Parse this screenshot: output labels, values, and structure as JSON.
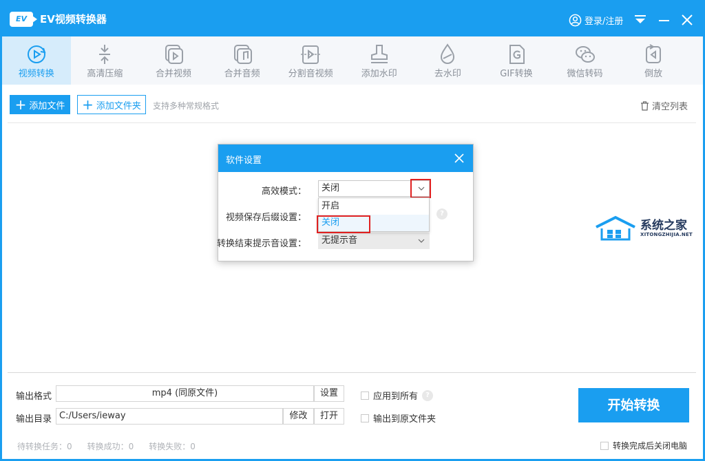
{
  "window": {
    "title": "EV视频转换器",
    "logo_text": "EV",
    "login_label": "登录/注册"
  },
  "toolbar": {
    "tools": [
      {
        "label": "视频转换",
        "icon": "video-convert-icon",
        "active": true
      },
      {
        "label": "高清压缩",
        "icon": "compress-icon"
      },
      {
        "label": "合并视频",
        "icon": "merge-video-icon"
      },
      {
        "label": "合并音频",
        "icon": "merge-audio-icon"
      },
      {
        "label": "分割音视频",
        "icon": "split-icon"
      },
      {
        "label": "添加水印",
        "icon": "stamp-icon"
      },
      {
        "label": "去水印",
        "icon": "drop-icon"
      },
      {
        "label": "GIF转换",
        "icon": "gif-icon"
      },
      {
        "label": "微信转码",
        "icon": "wechat-icon"
      },
      {
        "label": "倒放",
        "icon": "reverse-icon"
      }
    ]
  },
  "actions": {
    "add_file": "添加文件",
    "add_folder": "添加文件夹",
    "support_text": "支持多种常规格式",
    "clear_list": "清空列表"
  },
  "output": {
    "format_label": "输出格式",
    "format_value": "mp4 (同原文件)",
    "settings_button": "设置",
    "apply_all": "应用到所有",
    "dir_label": "输出目录",
    "dir_value": "C:/Users/ieway",
    "modify_button": "修改",
    "open_button": "打开",
    "output_to_source": "输出到原文件夹",
    "start_button": "开始转换",
    "shutdown_label": "转换完成后关闭电脑"
  },
  "stats": {
    "pending": "待转换任务：0",
    "success": "转换成功：0",
    "failed": "转换失败：0"
  },
  "dialog": {
    "title": "软件设置",
    "efficient_mode_label": "高效模式：",
    "efficient_mode_value": "关闭",
    "suffix_label": "视频保存后缀设置：",
    "sound_label": "转换结束提示音设置：",
    "sound_value": "无提示音",
    "options": [
      "开启",
      "关闭"
    ]
  },
  "watermark": {
    "text": "系统之家",
    "sub": "XITONGZHIJIA.NET"
  },
  "colors": {
    "accent": "#1a9ef0",
    "highlight": "#e02020"
  }
}
